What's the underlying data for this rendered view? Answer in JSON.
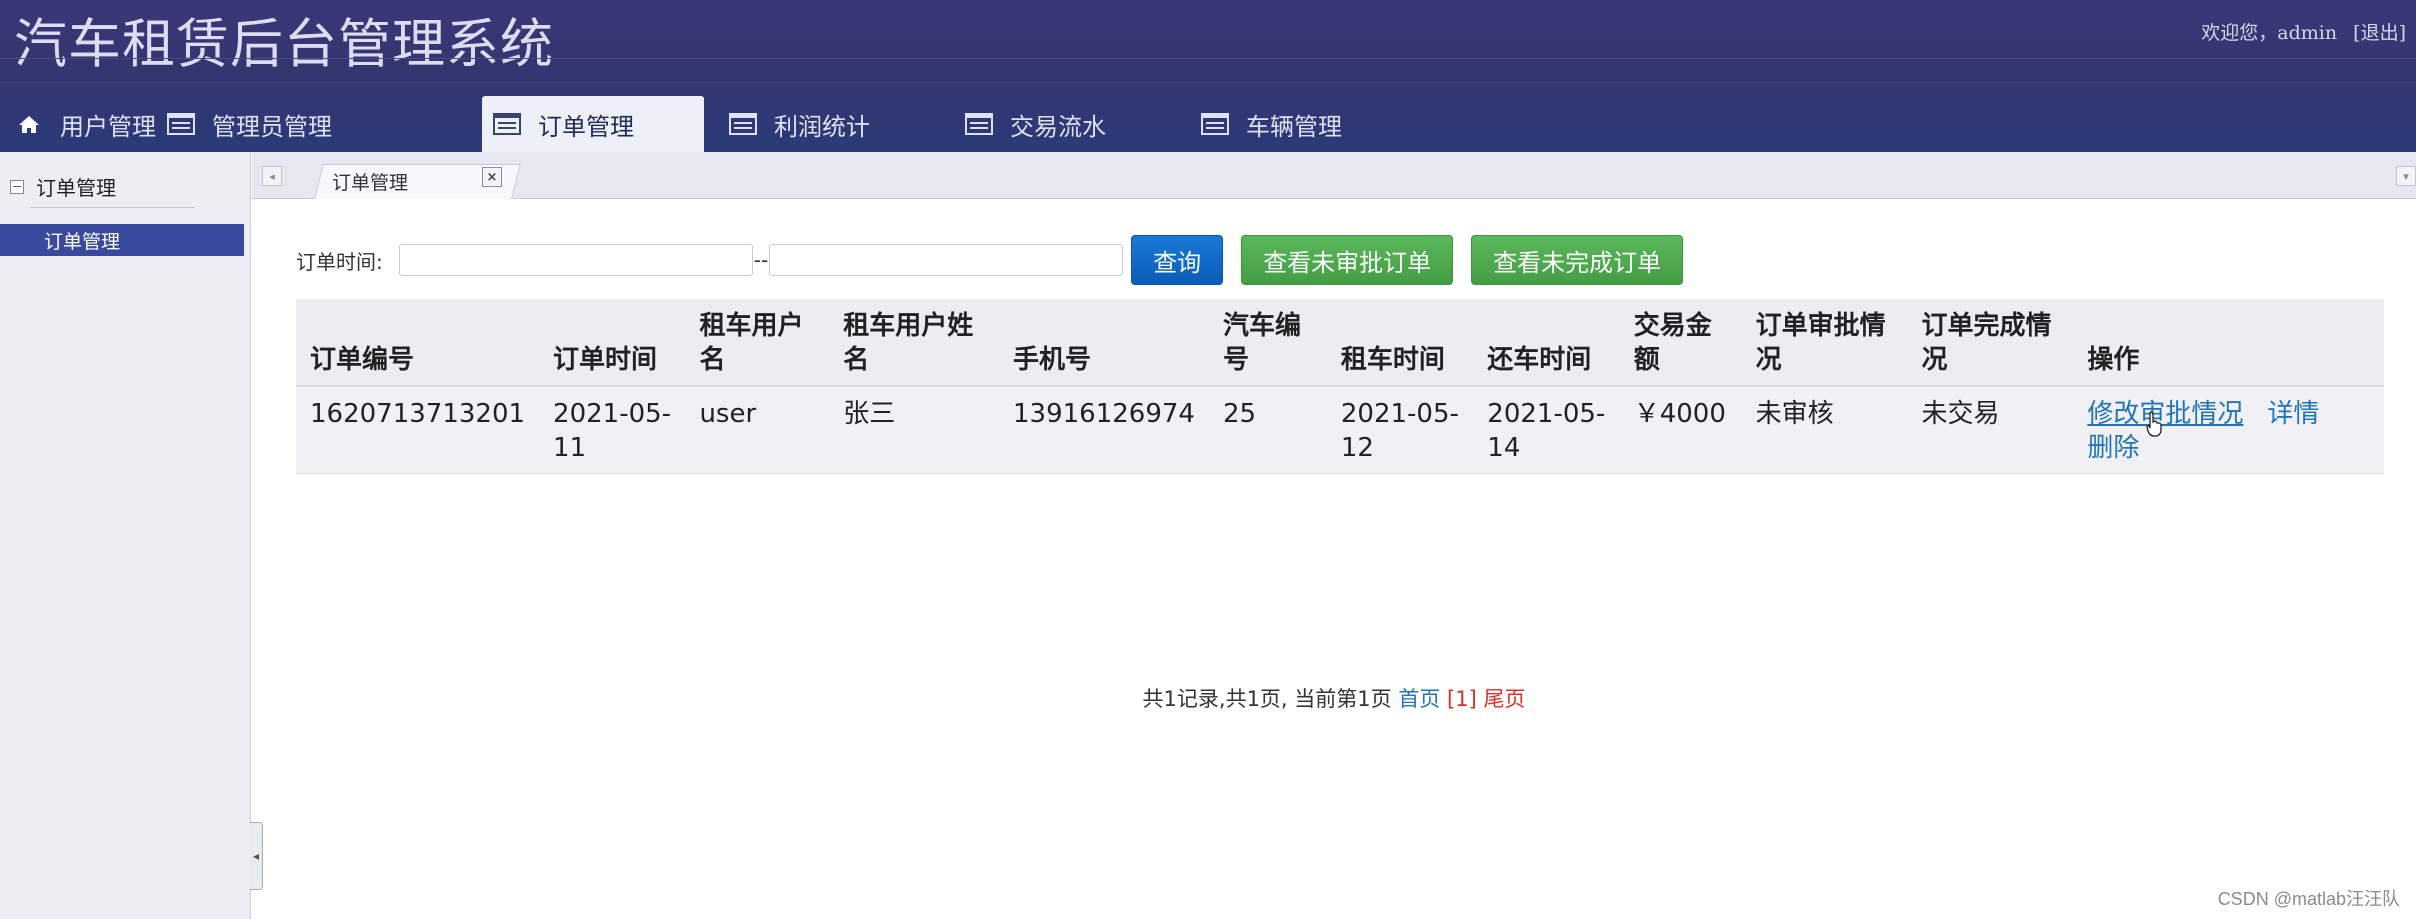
{
  "header": {
    "title": "汽车租赁后台管理系统",
    "welcome": "欢迎您，admin",
    "logout": "[退出]"
  },
  "nav": {
    "tabs": [
      {
        "label": "用户管理",
        "icon": "home-icon"
      },
      {
        "label": "管理员管理",
        "icon": "list-icon"
      },
      {
        "label": "订单管理",
        "icon": "list-icon",
        "active": true
      },
      {
        "label": "利润统计",
        "icon": "list-icon"
      },
      {
        "label": "交易流水",
        "icon": "list-icon"
      },
      {
        "label": "车辆管理",
        "icon": "list-icon"
      }
    ]
  },
  "sidebar": {
    "group": "订单管理",
    "items": [
      {
        "label": "订单管理",
        "selected": true
      }
    ]
  },
  "tabbar": {
    "open_tab": "订单管理",
    "close_symbol": "×"
  },
  "filter": {
    "label": "订单时间:",
    "separator": "--",
    "start_value": "",
    "end_value": "",
    "query_button": "查询",
    "unapproved_button": "查看未审批订单",
    "unfinished_button": "查看未完成订单"
  },
  "table": {
    "headers": [
      "订单编号",
      "订单时间",
      "租车用户名",
      "租车用户姓名",
      "手机号",
      "汽车编号",
      "租车时间",
      "还车时间",
      "交易金额",
      "订单审批情况",
      "订单完成情况",
      "操作"
    ],
    "rows": [
      {
        "order_no": "1620713713201",
        "order_time": "2021-05-11",
        "username": "user",
        "name": "张三",
        "phone": "13916126974",
        "car_no": "25",
        "rent_time": "2021-05-12",
        "return_time": "2021-05-14",
        "amount": "￥4000",
        "approval": "未审核",
        "completion": "未交易",
        "op_modify": "修改审批情况",
        "op_detail": "详情",
        "op_delete": "删除"
      }
    ]
  },
  "pager": {
    "summary": "共1记录,共1页, 当前第1页",
    "first": "首页",
    "current": "[1]",
    "last": "尾页"
  },
  "watermark": "CSDN @matlab汪汪队",
  "colors": {
    "header_bg": "#3b3778",
    "sidebar_selected": "#394a9e",
    "query_button": "#0a5cb8",
    "green_button": "#449d44",
    "link": "#1f75b5",
    "pager_red": "#d9302a"
  }
}
